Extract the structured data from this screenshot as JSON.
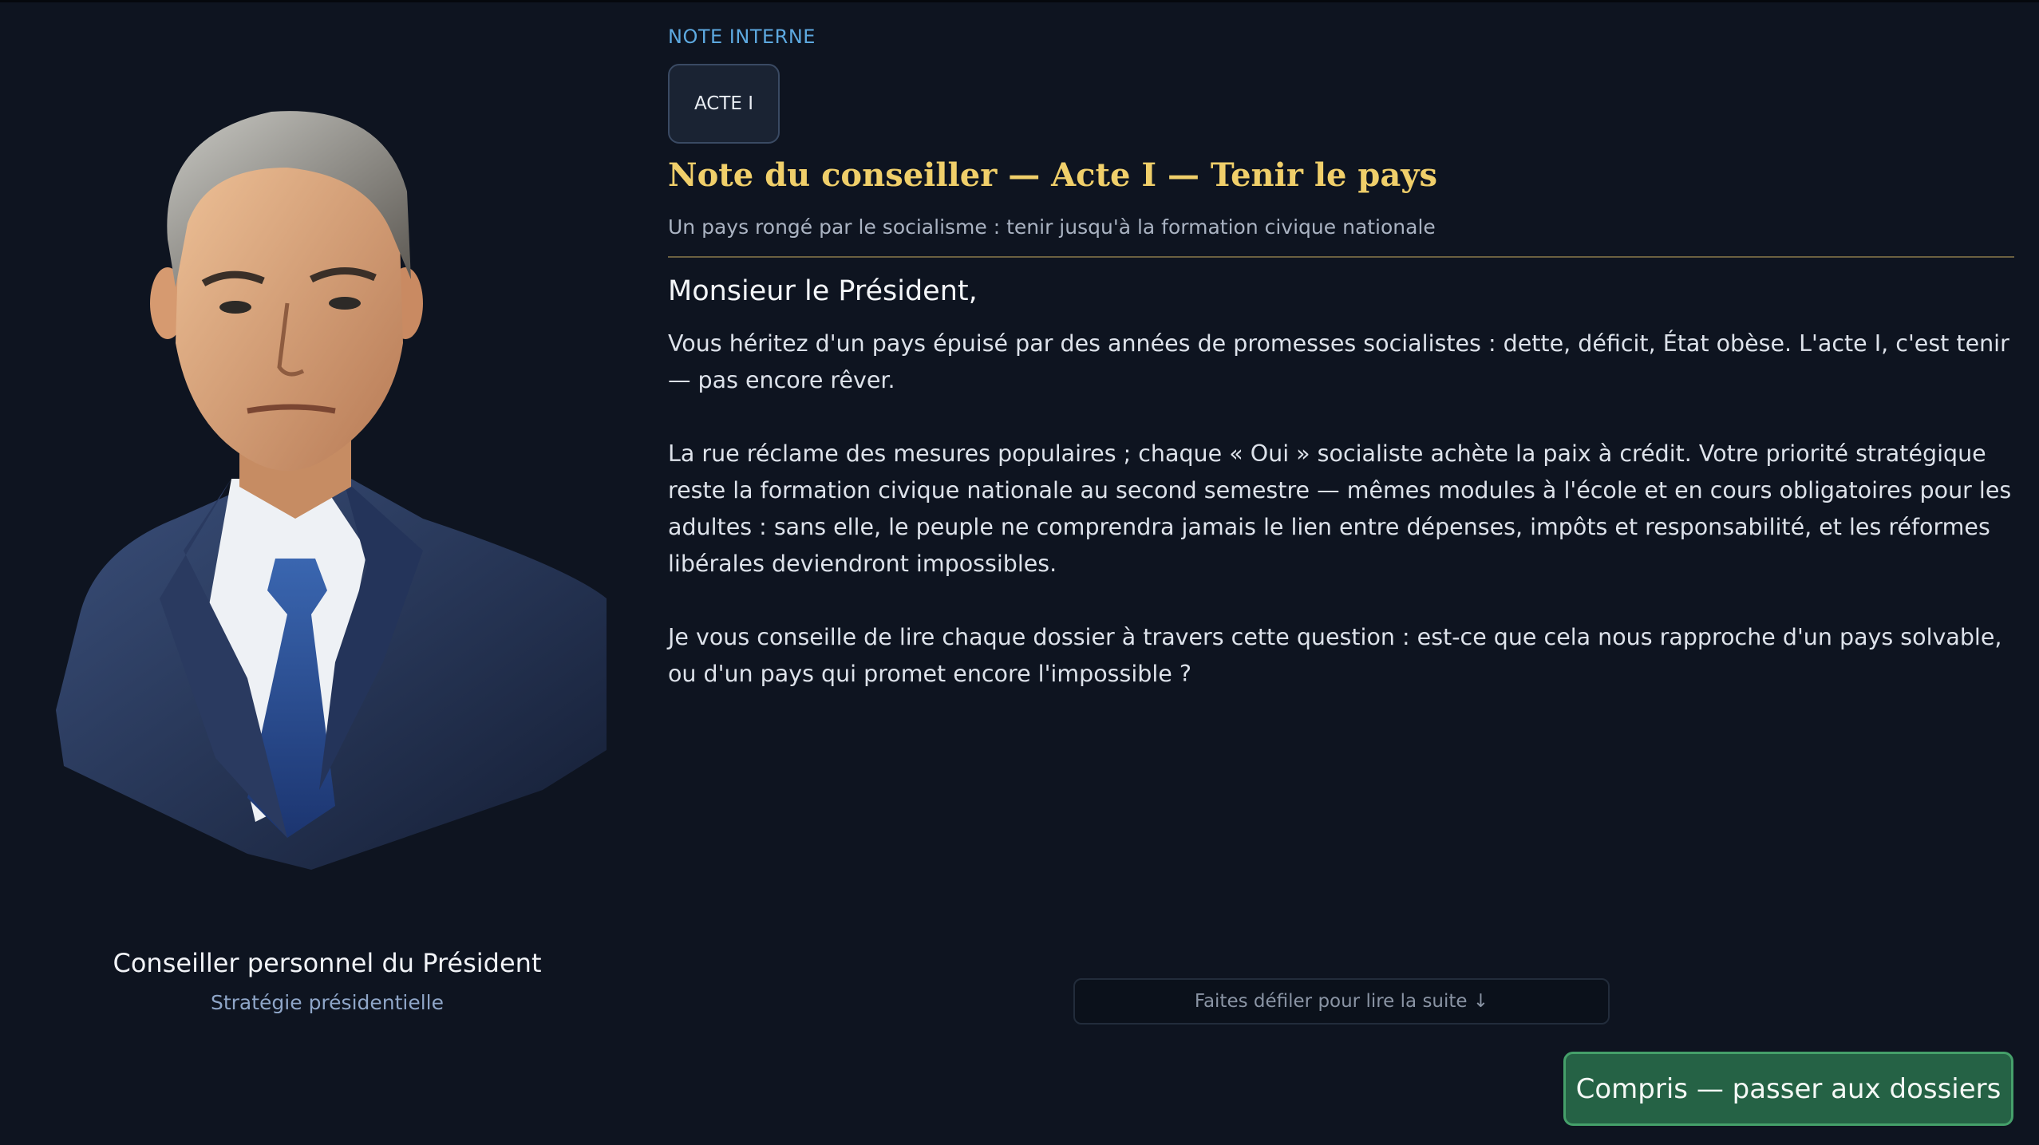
{
  "advisor": {
    "portrait_icon": "advisor-portrait",
    "name": "Conseiller personnel du Président",
    "role": "Stratégie présidentielle"
  },
  "note": {
    "kicker": "NOTE INTERNE",
    "act_badge": "ACTE I",
    "title": "Note du conseiller — Acte I — Tenir le pays",
    "subtitle": "Un pays rongé par le socialisme : tenir jusqu'à la formation civique nationale",
    "salutation": "Monsieur le Président,",
    "paragraphs": [
      "Vous héritez d'un pays épuisé par des années de promesses socialistes : dette, déficit, État obèse. L'acte I, c'est tenir — pas encore rêver.",
      "La rue réclame des mesures populaires ; chaque « Oui » socialiste achète la paix à crédit. Votre priorité stratégique reste la formation civique nationale au second semestre — mêmes modules à l'école et en cours obligatoires pour les adultes : sans elle, le peuple ne comprendra jamais le lien entre dépenses, impôts et responsabilité, et les réformes libérales deviendront impossibles.",
      "Je vous conseille de lire chaque dossier à travers cette question : est-ce que cela nous rapproche d'un pays solvable, ou d'un pays qui promet encore l'impossible ?"
    ]
  },
  "footer": {
    "scroll_hint": "Faites défiler pour lire la suite ↓",
    "confirm_label": "Compris — passer aux dossiers"
  },
  "colors": {
    "background": "#0e1420",
    "title_gold": "#f0cf6a",
    "kicker_blue": "#5da9e0",
    "button_green": "#256245"
  }
}
